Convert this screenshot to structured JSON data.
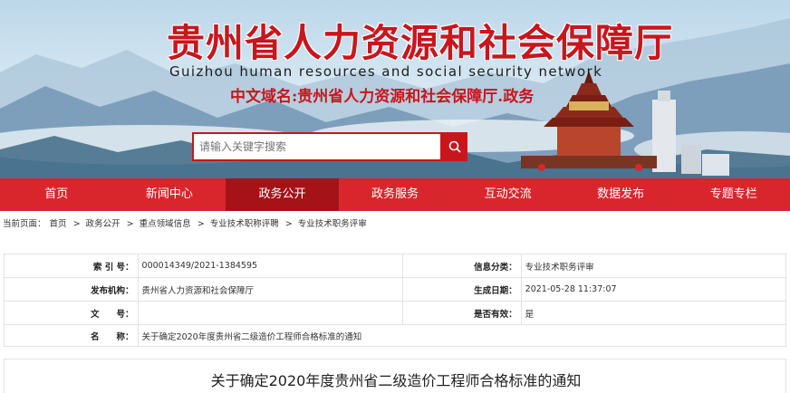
{
  "header": {
    "title": "贵州省人力资源和社会保障厅",
    "subtitle": "Guizhou human resources and social security network",
    "domain": "中文域名:贵州省人力资源和社会保障厅.政务",
    "search_placeholder": "请输入关键字搜索",
    "search_icon": "search-icon"
  },
  "nav": {
    "items": [
      {
        "label": "首页"
      },
      {
        "label": "新闻中心"
      },
      {
        "label": "政务公开"
      },
      {
        "label": "政务服务"
      },
      {
        "label": "互动交流"
      },
      {
        "label": "数据发布"
      },
      {
        "label": "专题专栏"
      }
    ],
    "active_index": 2
  },
  "breadcrumb": {
    "prefix": "当前页面：",
    "items": [
      "首页",
      "政务公开",
      "重点领域信息",
      "专业技术职称评聘",
      "专业技术职务评审"
    ],
    "separator": ">"
  },
  "info": {
    "index_label": "索 引 号：",
    "index_value": "000014349/2021-1384595",
    "category_label": "信息分类：",
    "category_value": "专业技术职务评审",
    "publisher_label": "发布机构：",
    "publisher_value": "贵州省人力资源和社会保障厅",
    "date_label": "生成日期：",
    "date_value": "2021-05-28 11:37:07",
    "docno_label": "文　　号：",
    "docno_value": "",
    "valid_label": "是否有效：",
    "valid_value": "是",
    "name_label": "名　　称：",
    "name_value": "关于确定2020年度贵州省二级造价工程师合格标准的通知"
  },
  "article": {
    "title": "关于确定2020年度贵州省二级造价工程师合格标准的通知"
  },
  "colors": {
    "brand_red": "#d9262c",
    "active_red": "#a51218",
    "title_red": "#c8161d"
  }
}
